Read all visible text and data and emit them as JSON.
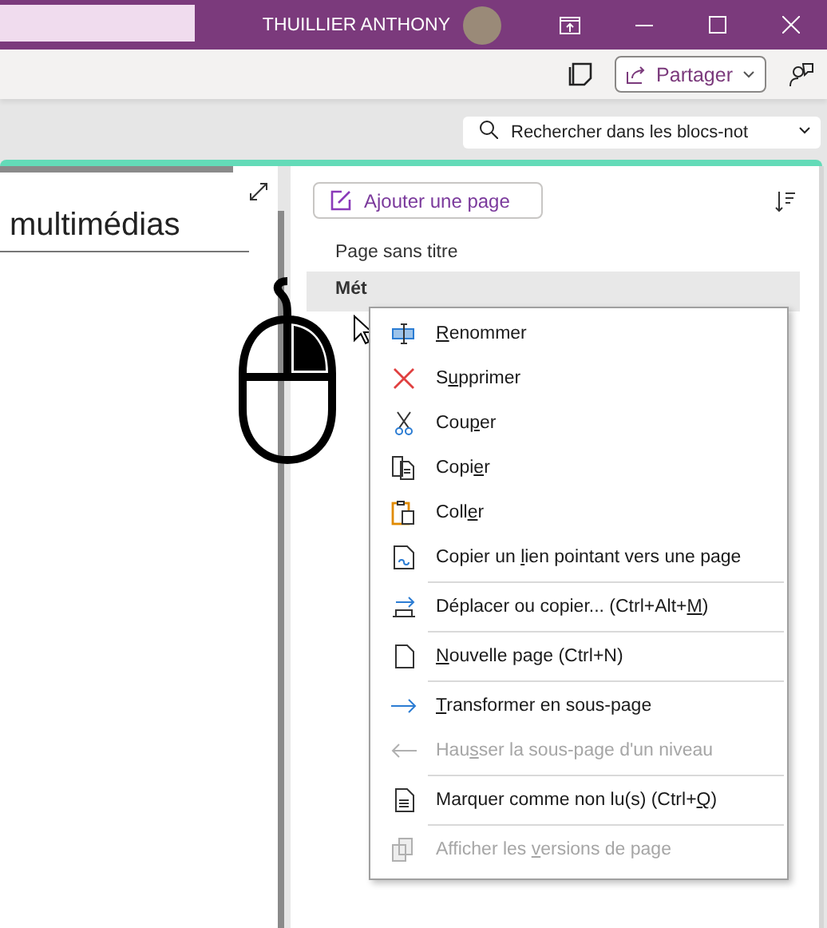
{
  "title_bar": {
    "user_name": "THUILLIER ANTHONY"
  },
  "toolbar": {
    "share_button": "Partager"
  },
  "search": {
    "placeholder": "Rechercher dans les blocs-not"
  },
  "page_title": "multimédias",
  "pages_panel": {
    "add_page_button": "Ajouter une page",
    "pages": [
      {
        "title": "Page sans titre",
        "selected": false
      },
      {
        "title": "Mét",
        "selected": true
      }
    ]
  },
  "context_menu": {
    "items": [
      {
        "kind": "item",
        "disabled": false,
        "segments": [
          {
            "text": "R",
            "underline": true
          },
          {
            "text": "enommer",
            "underline": false
          }
        ]
      },
      {
        "kind": "item",
        "disabled": false,
        "segments": [
          {
            "text": "S",
            "underline": false
          },
          {
            "text": "u",
            "underline": true
          },
          {
            "text": "pprimer",
            "underline": false
          }
        ]
      },
      {
        "kind": "item",
        "disabled": false,
        "segments": [
          {
            "text": "Cou",
            "underline": false
          },
          {
            "text": "p",
            "underline": true
          },
          {
            "text": "er",
            "underline": false
          }
        ]
      },
      {
        "kind": "item",
        "disabled": false,
        "segments": [
          {
            "text": "Copi",
            "underline": false
          },
          {
            "text": "e",
            "underline": true
          },
          {
            "text": "r",
            "underline": false
          }
        ]
      },
      {
        "kind": "item",
        "disabled": false,
        "segments": [
          {
            "text": "Coll",
            "underline": false
          },
          {
            "text": "e",
            "underline": true
          },
          {
            "text": "r",
            "underline": false
          }
        ]
      },
      {
        "kind": "item",
        "disabled": false,
        "segments": [
          {
            "text": "Copier un ",
            "underline": false
          },
          {
            "text": "l",
            "underline": true
          },
          {
            "text": "ien pointant vers une page",
            "underline": false
          }
        ]
      },
      {
        "kind": "separator"
      },
      {
        "kind": "item",
        "disabled": false,
        "segments": [
          {
            "text": "Déplacer ou copier...  (Ctrl+Alt+",
            "underline": false
          },
          {
            "text": "M",
            "underline": true
          },
          {
            "text": ")",
            "underline": false
          }
        ]
      },
      {
        "kind": "separator"
      },
      {
        "kind": "item",
        "disabled": false,
        "segments": [
          {
            "text": "N",
            "underline": true
          },
          {
            "text": "ouvelle page  (Ctrl+N)",
            "underline": false
          }
        ]
      },
      {
        "kind": "separator"
      },
      {
        "kind": "item",
        "disabled": false,
        "segments": [
          {
            "text": "T",
            "underline": true
          },
          {
            "text": "ransformer en sous-page",
            "underline": false
          }
        ]
      },
      {
        "kind": "item",
        "disabled": true,
        "segments": [
          {
            "text": "Hau",
            "underline": false
          },
          {
            "text": "s",
            "underline": true
          },
          {
            "text": "ser la sous-page d'un niveau",
            "underline": false
          }
        ]
      },
      {
        "kind": "separator"
      },
      {
        "kind": "item",
        "disabled": false,
        "segments": [
          {
            "text": "Marquer comme non lu(s)  (Ctrl+",
            "underline": false
          },
          {
            "text": "Q",
            "underline": true
          },
          {
            "text": ")",
            "underline": false
          }
        ]
      },
      {
        "kind": "separator"
      },
      {
        "kind": "item",
        "disabled": true,
        "segments": [
          {
            "text": "Afficher les ",
            "underline": false
          },
          {
            "text": "v",
            "underline": true
          },
          {
            "text": "ersions de page",
            "underline": false
          }
        ]
      }
    ]
  }
}
